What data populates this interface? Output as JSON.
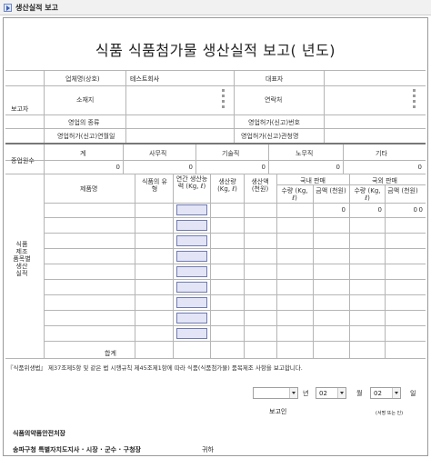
{
  "window": {
    "title": "생산실적 보고"
  },
  "doc": {
    "title": "식품 식품첨가물 생산실적 보고(  년도)"
  },
  "reporter": {
    "section_label": "보고자",
    "company_label": "업체명(상호)",
    "company_value": "테스트회사",
    "ceo_label": "대표자",
    "address_label": "소재지",
    "contact_label": "연락처",
    "business_type_label": "영업의 종류",
    "license_no_label": "영업허가(신고)번호",
    "license_date_label": "영업허가(신고)연월일",
    "license_office_label": "영업허가(신고)관청명"
  },
  "employees": {
    "section_label": "종업원수",
    "columns": [
      "계",
      "사무직",
      "기술직",
      "노무직",
      "기타"
    ],
    "values": [
      "0",
      "0",
      "0",
      "0",
      "0"
    ]
  },
  "production": {
    "section_label": "식품 제조 품목별 생산 실적",
    "headers": {
      "product": "제품명",
      "type": "식품의 유형",
      "capacity": "연간 생산능력 (Kg, ℓ)",
      "output": "생산량 (Kg, ℓ)",
      "amount": "생산액 (천원)",
      "domestic": "국내 판매",
      "overseas": "국외 판매",
      "qty": "수량 (Kg, ℓ)",
      "value": "금액 (천원)"
    },
    "first_row_values": [
      "0",
      "0",
      "0",
      "0"
    ],
    "total_label": "합계"
  },
  "statement": "『식품위생법』 제37조제5항 및 같은 법 시행규칙 제45조제1항에 따라 식품(식품첨가물) 품목제조 사항을 보고합니다.",
  "date": {
    "year_unit": "년",
    "month_value": "02",
    "month_unit": "월",
    "day_value": "02",
    "day_unit": "일"
  },
  "signer": {
    "label": "보고인",
    "seal": "(서명 또는 인)"
  },
  "recipient": {
    "title": "식품의약품안전처장",
    "line": "송파구청 특별자치도지사 · 시장 · 군수 · 구청장",
    "suffix": "귀하"
  }
}
